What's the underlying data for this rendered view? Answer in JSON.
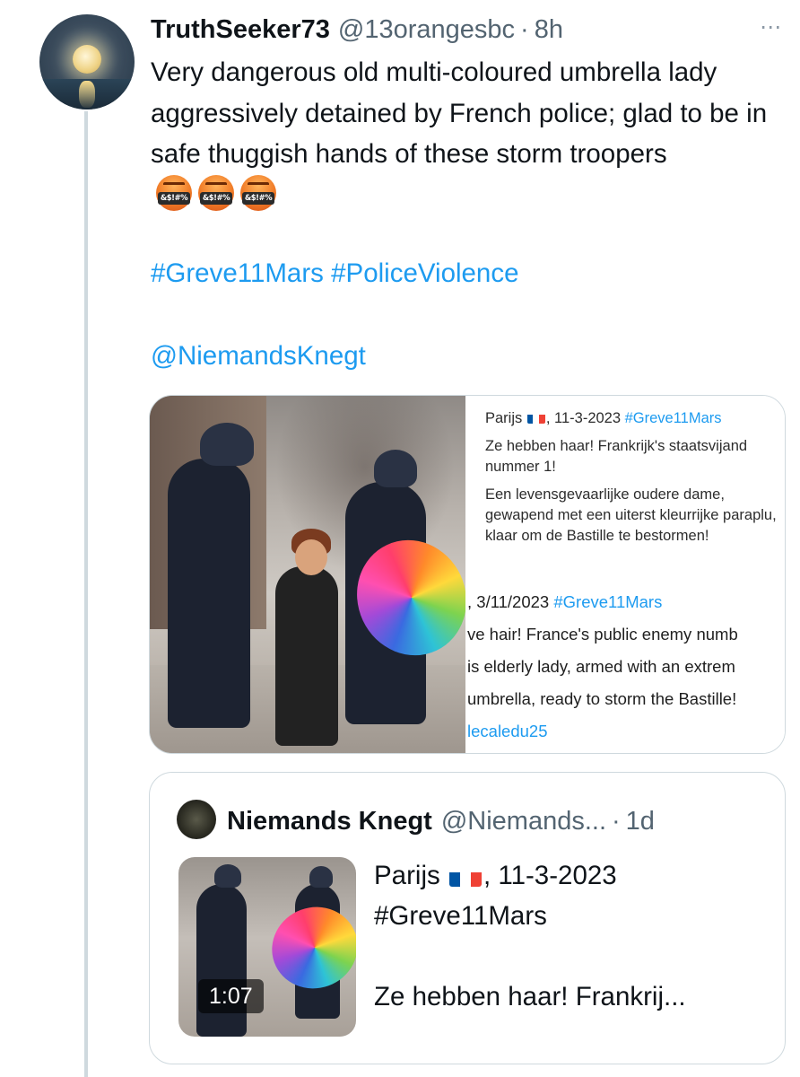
{
  "tweet": {
    "display_name": "TruthSeeker73",
    "handle": "@13orangesbc",
    "separator": "·",
    "time": "8h",
    "text": "Very dangerous old multi-coloured umbrella lady aggressively detained by French police; glad to be in safe thuggish hands of these storm troopers",
    "emoji_label": "&$!#%",
    "emoji_name": "face-with-symbols-on-mouth",
    "hashtags": "#Greve11Mars #PoliceViolence",
    "mention": "@NiemandsKnegt",
    "more_icon": "⋯"
  },
  "media_card": {
    "nl_city": "Parijs",
    "nl_date": ", 11-3-2023 ",
    "nl_hashtag": "#Greve11Mars",
    "nl_line1": "Ze hebben haar! Frankrijk's staatsvijand nummer 1!",
    "nl_line2": "Een levensgevaarlijke oudere dame, gewapend met een uiterst kleurrijke paraplu, klaar om de Bastille te bestormen!",
    "en_date": ", 3/11/2023 ",
    "en_hashtag": "#Greve11Mars",
    "en_line1": "ve hair! France's public enemy numb",
    "en_line2": "is elderly lady, armed with an extrem",
    "en_line3": "umbrella, ready to storm the Bastille!",
    "en_link": "lecaledu25"
  },
  "quote": {
    "display_name": "Niemands Knegt",
    "handle": "@Niemands...",
    "separator": "·",
    "time": "1d",
    "duration": "1:07",
    "text_city": "Parijs",
    "text_date": ", 11-3-2023",
    "text_hashtag": "#Greve11Mars",
    "text_preview": "Ze hebben haar! Frankrij..."
  },
  "colors": {
    "link": "#1d9bf0",
    "secondary_text": "#536471",
    "border": "#cfd9de",
    "flag_blue": "#0055a4",
    "flag_white": "#ffffff",
    "flag_red": "#ef4135"
  }
}
